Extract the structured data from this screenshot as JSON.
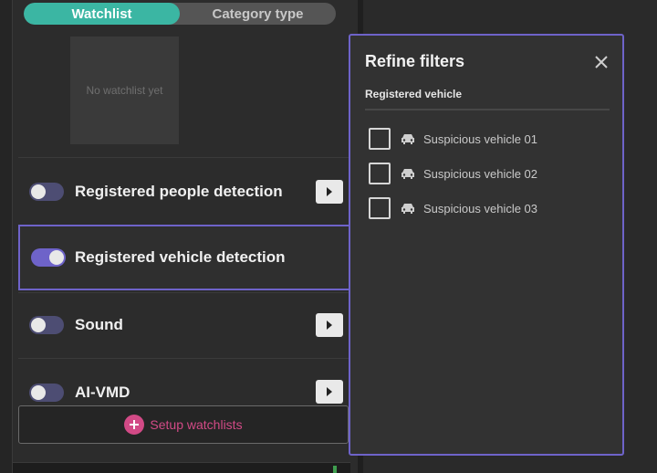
{
  "tabs": [
    {
      "label": "Watchlist",
      "active": true
    },
    {
      "label": "Category type",
      "active": false
    }
  ],
  "watchlist": {
    "empty_text": "No watchlist yet"
  },
  "rows": [
    {
      "label": "Registered people detection",
      "toggle_on": false,
      "has_arrow": true
    },
    {
      "label": "Registered vehicle detection",
      "toggle_on": true,
      "selected": true,
      "has_arrow": false
    },
    {
      "label": "Sound",
      "toggle_on": false,
      "has_arrow": true
    },
    {
      "label": "AI-VMD",
      "toggle_on": false,
      "has_arrow": true
    }
  ],
  "setup_button": {
    "label": "Setup watchlists"
  },
  "popup": {
    "title": "Refine filters",
    "section": "Registered vehicle",
    "items": [
      {
        "label": "Suspicious vehicle 01",
        "checked": false
      },
      {
        "label": "Suspicious vehicle 02",
        "checked": false
      },
      {
        "label": "Suspicious vehicle 03",
        "checked": false
      }
    ]
  },
  "colors": {
    "accent_teal": "#3bb6a3",
    "accent_purple": "#6e63c9",
    "accent_pink": "#d24a86"
  }
}
